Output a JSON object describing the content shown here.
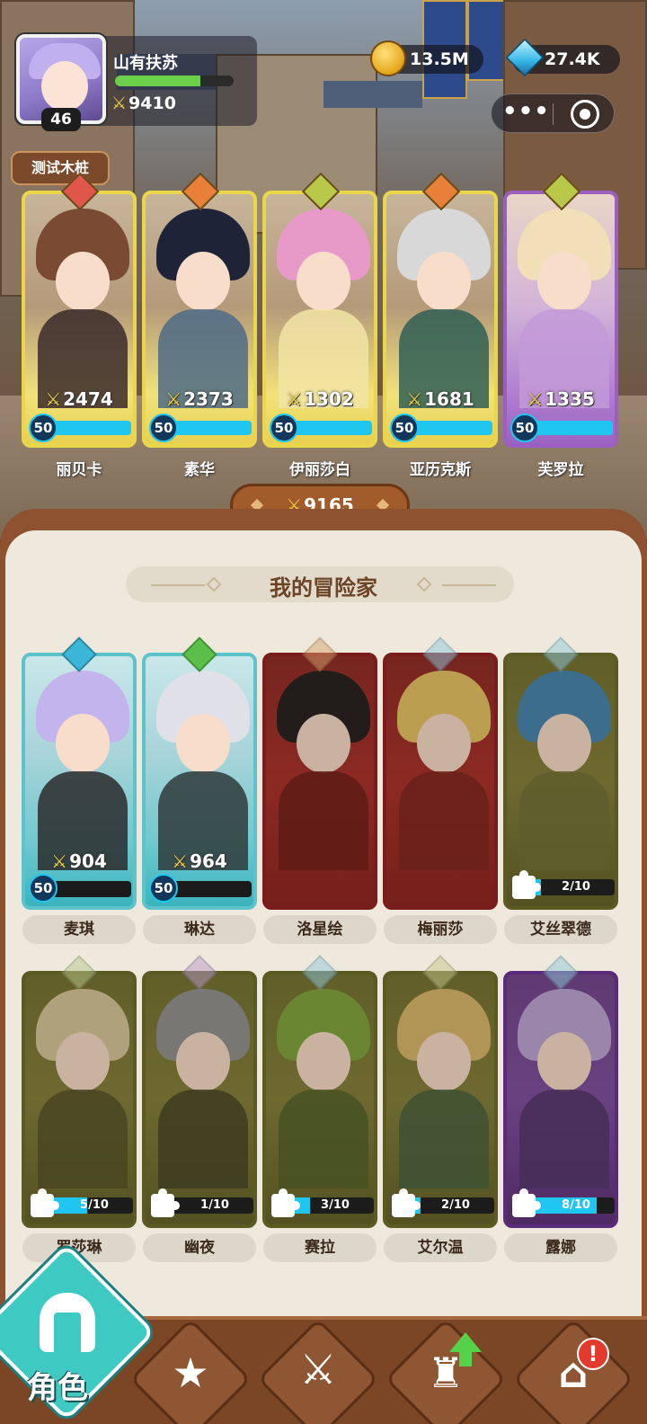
{
  "player": {
    "name": "山有扶苏",
    "level": "46",
    "power": "9410",
    "xp_fraction": 0.72
  },
  "currency": {
    "gold": "13.5M",
    "gems": "27.4K"
  },
  "menu": {
    "more_glyph": "•••"
  },
  "test_dummy_label": "测试木桩",
  "team": [
    {
      "name": "丽贝卡",
      "power": "2474",
      "level": "50",
      "hair": "#7a4a32",
      "body": "#3a2a2a",
      "gem": "#e0564a",
      "card": "gold"
    },
    {
      "name": "素华",
      "power": "2373",
      "level": "50",
      "hair": "#1f2338",
      "body": "#4e6b86",
      "gem": "#e8803a",
      "card": "gold"
    },
    {
      "name": "伊丽莎白",
      "power": "1302",
      "level": "50",
      "hair": "#e79ac8",
      "body": "#f1e5a5",
      "gem": "#b8c94a",
      "card": "gold"
    },
    {
      "name": "亚历克斯",
      "power": "1681",
      "level": "50",
      "hair": "#d8d8d8",
      "body": "#2f5f55",
      "gem": "#e8803a",
      "card": "gold"
    },
    {
      "name": "芙罗拉",
      "power": "1335",
      "level": "50",
      "hair": "#f1dfb8",
      "body": "#c39ad8",
      "gem": "#b8c94a",
      "card": "purple"
    }
  ],
  "team_total_power": "9165",
  "roster_title": "我的冒险家",
  "roster": [
    {
      "name": "麦琪",
      "owned": true,
      "power": "904",
      "level": "50",
      "style": "teal",
      "hair": "#c4b4ee",
      "body": "#2a2a2a",
      "gem": "#3cb6d8"
    },
    {
      "name": "琳达",
      "owned": true,
      "power": "964",
      "level": "50",
      "style": "teal",
      "hair": "#e0e0e8",
      "body": "#2f3a3a",
      "gem": "#5bc04a"
    },
    {
      "name": "洛星绘",
      "owned": false,
      "shards": "",
      "style": "red",
      "hair": "#1a1418",
      "body": "#6a1212",
      "gem": "#d9a06a"
    },
    {
      "name": "梅丽莎",
      "owned": false,
      "shards": "",
      "style": "red",
      "hair": "#e6c060",
      "body": "#7a1a1a",
      "gem": "#8ec9dc"
    },
    {
      "name": "艾丝翠德",
      "owned": false,
      "shards": "2/10",
      "shard_fraction": 0.2,
      "style": "olive",
      "hair": "#3e7fb0",
      "body": "#6b6a30",
      "gem": "#8ec9dc"
    },
    {
      "name": "罗莎琳",
      "owned": false,
      "shards": "5/10",
      "shard_fraction": 0.5,
      "style": "olive",
      "hair": "#d4c49a",
      "body": "#4f4a22",
      "gem": "#b9c98a"
    },
    {
      "name": "幽夜",
      "owned": false,
      "shards": "1/10",
      "shard_fraction": 0.1,
      "style": "olive",
      "hair": "#8d8d90",
      "body": "#3f3d22",
      "gem": "#b89acb"
    },
    {
      "name": "赛拉",
      "owned": false,
      "shards": "3/10",
      "shard_fraction": 0.3,
      "style": "olive",
      "hair": "#7ba03a",
      "body": "#4a5a22",
      "gem": "#8ec9dc"
    },
    {
      "name": "艾尔温",
      "owned": false,
      "shards": "2/10",
      "shard_fraction": 0.2,
      "style": "olive",
      "hair": "#d9b46a",
      "body": "#3f5a3a",
      "gem": "#c4c98a"
    },
    {
      "name": "露娜",
      "owned": false,
      "shards": "8/10",
      "shard_fraction": 0.8,
      "style": "violet",
      "hair": "#b9a0d8",
      "body": "#4a2a6a",
      "gem": "#8ec9dc"
    }
  ],
  "nav": {
    "active_label": "角色",
    "alert": "!"
  },
  "colors": {
    "panel_bg": "#efe9dd",
    "frame_brown": "#8e5230",
    "power_yellow": "#f3d33a",
    "level_cyan": "#1fc7f0",
    "active_teal": "#3ec9c2"
  }
}
